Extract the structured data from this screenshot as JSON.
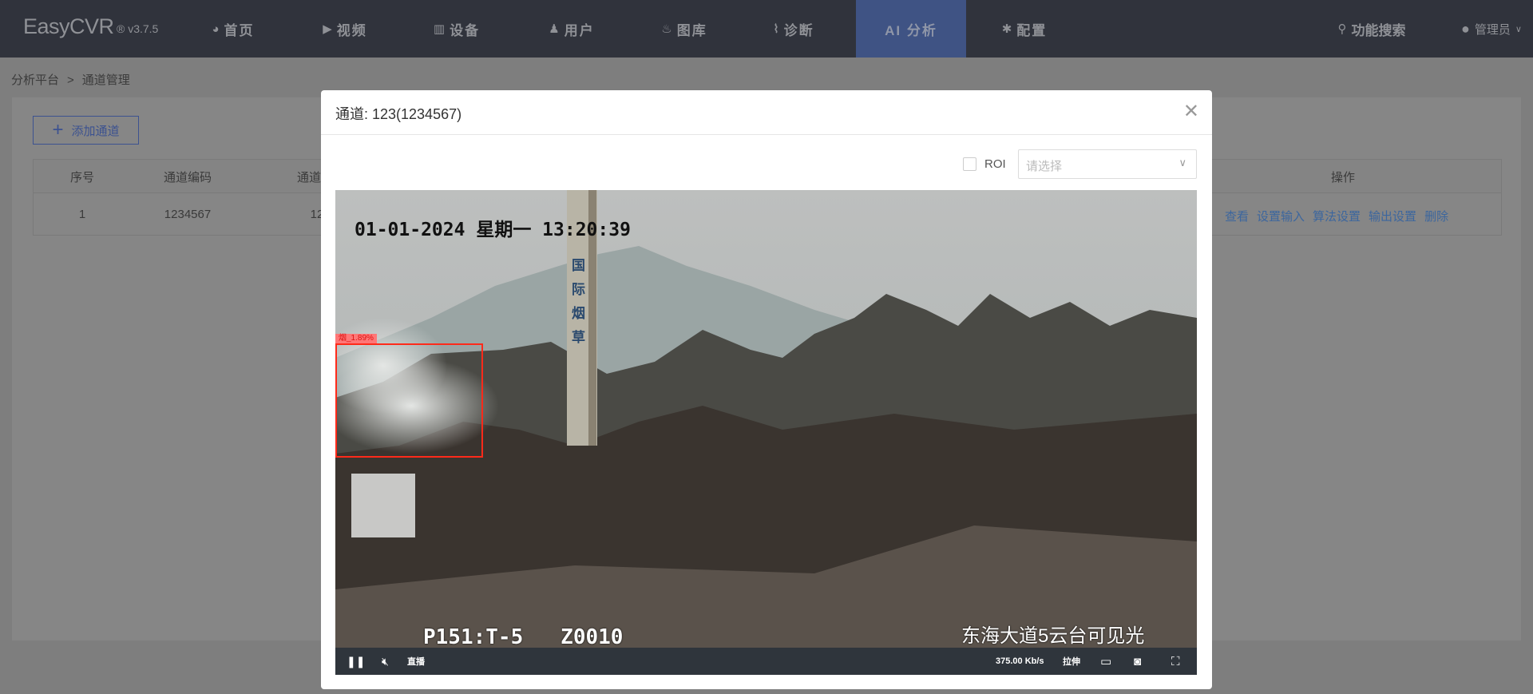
{
  "header": {
    "logo": "EasyCVR",
    "version": "® v3.7.5",
    "nav": [
      {
        "label": "首页",
        "icon": "dashboard-icon",
        "glyph": "◕"
      },
      {
        "label": "视频",
        "icon": "play-circle-icon",
        "glyph": "▶"
      },
      {
        "label": "设备",
        "icon": "barcode-icon",
        "glyph": "▥"
      },
      {
        "label": "用户",
        "icon": "user-icon",
        "glyph": "♟"
      },
      {
        "label": "图库",
        "icon": "alarm-icon",
        "glyph": "♨"
      },
      {
        "label": "诊断",
        "icon": "pulse-icon",
        "glyph": "⌇"
      },
      {
        "label": "AI 分析",
        "icon": "",
        "glyph": ""
      },
      {
        "label": "配置",
        "icon": "gear-icon",
        "glyph": "✱"
      }
    ],
    "active_nav": "AI 分析",
    "search": "功能搜索",
    "user": "管理员"
  },
  "breadcrumb": [
    "分析平台",
    ">",
    "通道管理"
  ],
  "main": {
    "add_button": "添加通道",
    "table": {
      "headers": [
        "序号",
        "通道编码",
        "通道",
        "操作"
      ],
      "rows": [
        {
          "cells": [
            "1",
            "1234567",
            "12"
          ],
          "actions": [
            "查看",
            "设置输入",
            "算法设置",
            "输出设置",
            "删除"
          ]
        }
      ]
    }
  },
  "modal": {
    "title": "通道: 123(1234567)",
    "roi_label": "ROI",
    "roi_checked": false,
    "select_placeholder": "请选择",
    "video": {
      "timestamp": "01-01-2024 星期一 13:20:39",
      "ptz": "P151:T-5   Z0010",
      "camera_name": "东海大道5云台可见光",
      "chimney_text": "国际烟草",
      "detection": {
        "label": "烟_1.89%",
        "color": "#ff2a1a"
      },
      "controls": {
        "live": "直播",
        "bitrate": "375.00 Kb/s",
        "stretch": "拉伸"
      }
    }
  },
  "colors": {
    "header_bg": "#30333c",
    "active_nav": "#3f5384",
    "link": "#3c669e"
  }
}
